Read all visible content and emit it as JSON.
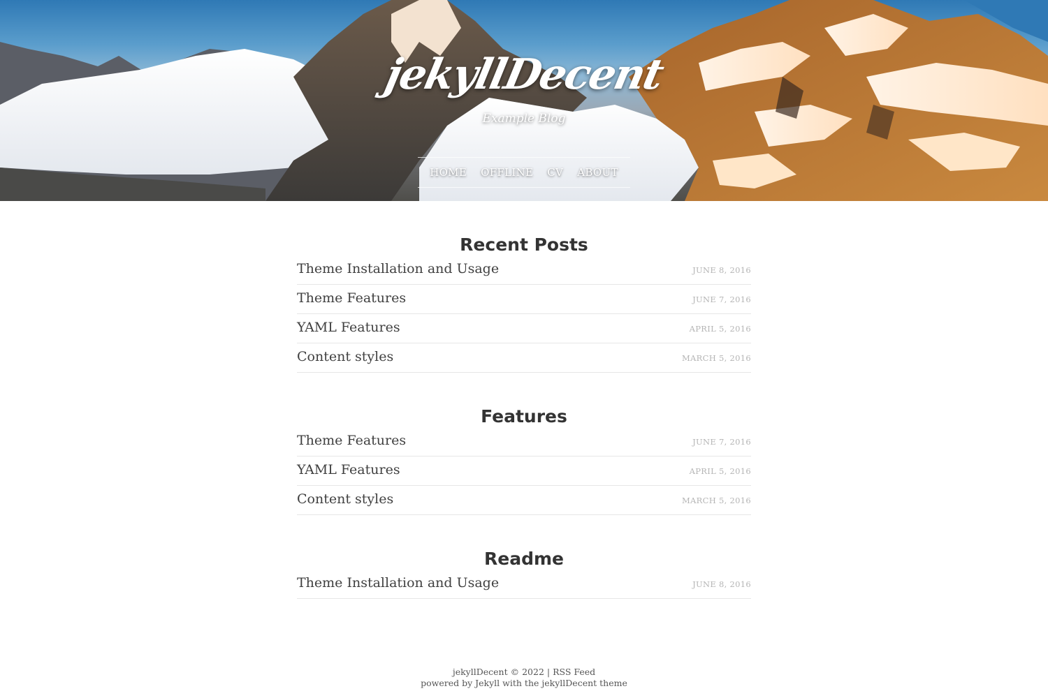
{
  "header": {
    "site_title": "jekyllDecent",
    "subtitle": "Example Blog",
    "nav": [
      {
        "label": "HOME"
      },
      {
        "label": "OFFLINE"
      },
      {
        "label": "CV"
      },
      {
        "label": "ABOUT"
      }
    ]
  },
  "sections": [
    {
      "title": "Recent Posts",
      "posts": [
        {
          "title": "Theme Installation and Usage",
          "date": "June 8, 2016"
        },
        {
          "title": "Theme Features",
          "date": "June 7, 2016"
        },
        {
          "title": "YAML Features",
          "date": "April 5, 2016"
        },
        {
          "title": "Content styles",
          "date": "March 5, 2016"
        }
      ]
    },
    {
      "title": "Features",
      "posts": [
        {
          "title": "Theme Features",
          "date": "June 7, 2016"
        },
        {
          "title": "YAML Features",
          "date": "April 5, 2016"
        },
        {
          "title": "Content styles",
          "date": "March 5, 2016"
        }
      ]
    },
    {
      "title": "Readme",
      "posts": [
        {
          "title": "Theme Installation and Usage",
          "date": "June 8, 2016"
        }
      ]
    }
  ],
  "footer": {
    "brand": "jekyllDecent",
    "copyright": "© 2022",
    "separator": "|",
    "rss_label": "RSS Feed",
    "powered_prefix": "powered by",
    "jekyll_label": "Jekyll",
    "with_text": "with the",
    "theme_label": "jekyllDecent theme"
  }
}
